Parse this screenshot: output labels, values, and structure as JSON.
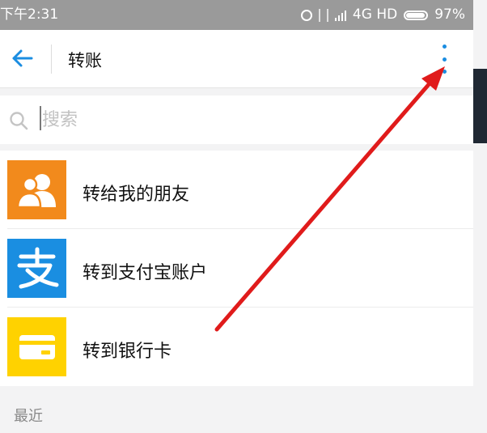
{
  "status_bar": {
    "time": "下午2:31",
    "network": "4G HD",
    "battery": "97%"
  },
  "header": {
    "title": "转账"
  },
  "search": {
    "placeholder": "搜索"
  },
  "transfer_options": [
    {
      "label": "转给我的朋友",
      "icon": "friends-icon",
      "color": "#f28a1c"
    },
    {
      "label": "转到支付宝账户",
      "icon": "alipay-icon",
      "color": "#1a8ee1"
    },
    {
      "label": "转到银行卡",
      "icon": "bank-card-icon",
      "color": "#ffd200"
    }
  ],
  "recent_section": {
    "label": "最近"
  },
  "annotation": {
    "arrow_color": "#e01b1b"
  },
  "colors": {
    "accent": "#1b8de1",
    "status_bar": "#9a9a9a",
    "background": "#f3f3f4"
  }
}
